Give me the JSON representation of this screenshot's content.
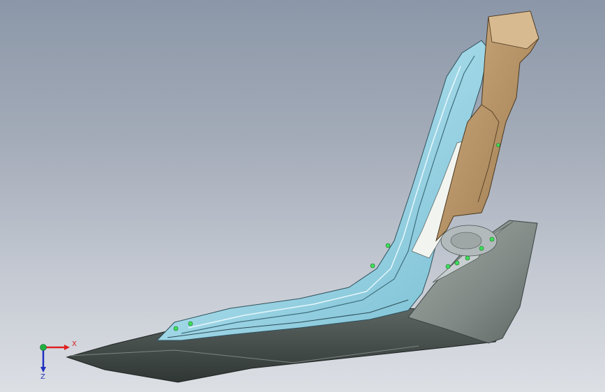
{
  "viewport": {
    "background_top": "#8b97a8",
    "background_bottom": "#dcdfe4",
    "model_colors": {
      "trim_light_blue": "#a8dcea",
      "trim_blue_shadow": "#6fb6cc",
      "base_dark_gray": "#3e4744",
      "base_mid_gray": "#6b7471",
      "end_cap_gray": "#8e9692",
      "headrest_tan": "#b5946a",
      "headrest_tan_dark": "#8d6f4a",
      "fastener_green": "#3ee05a"
    }
  },
  "triad": {
    "x_label": "X",
    "z_label": "Z",
    "x_color": "#e02020",
    "y_color": "#20b040",
    "z_color": "#2030c0"
  }
}
